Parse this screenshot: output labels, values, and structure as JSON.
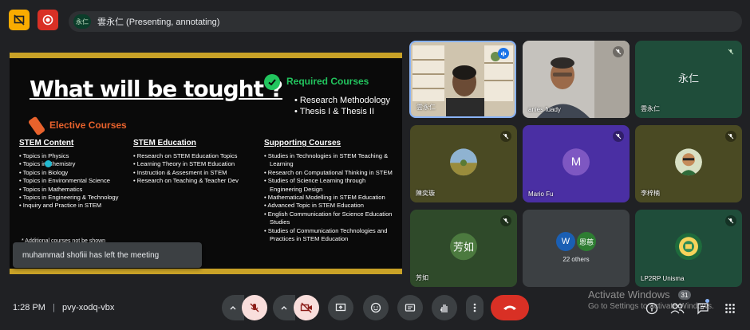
{
  "presenter": {
    "avatar_text": "永仁",
    "label": "雲永仁 (Presenting, annotating)"
  },
  "slide": {
    "title": "What will be tought ?",
    "required": {
      "heading": "Required Courses",
      "items": [
        "Research Methodology",
        "Thesis I & Thesis II"
      ]
    },
    "elective_heading": "Elective Courses",
    "columns": [
      {
        "heading": "STEM Content",
        "items": [
          "Topics in Physics",
          "Topics in Chemistry",
          "Topics in Biology",
          "Topics in Environmental Science",
          "Topics in Mathematics",
          "Topics in Engineering & Technology",
          "Inquiry and Practice in STEM"
        ]
      },
      {
        "heading": "STEM Education",
        "items": [
          "Research on STEM Education Topics",
          "Learning Theory in STEM Education",
          "Instruction & Assesment in STEM",
          "Research on Teaching & Teacher Dev"
        ]
      },
      {
        "heading": "Supporting Courses",
        "items": [
          "Studies in Technologies in STEM Teaching & Learning",
          "Research on Computational Thinking in STEM",
          "Studies of Science Learning through Engineering Design",
          "Mathematical Modelling in STEM Education",
          "Advanced Topic in STEM Education",
          "English Communication for Science Education Studies",
          "Studies of Communication Technologies and Practices in STEM Education"
        ]
      }
    ],
    "note": "* Additional courses not be shown"
  },
  "toast": "muhammad shofiii has left the meeting",
  "participants": {
    "t1": {
      "name": "雲永仁"
    },
    "t2": {
      "name": "anies fuady"
    },
    "t3": {
      "avatar": "永仁",
      "name": "雲永仁"
    },
    "t4": {
      "name": "陳奕璇"
    },
    "t5": {
      "avatar": "M",
      "name": "Mario Fu"
    },
    "t6": {
      "name": "李梓楠"
    },
    "t7": {
      "avatar": "芳如",
      "name": "芳如"
    },
    "t8": {
      "avatar_w": "W",
      "avatar_e": "恩慈",
      "label": "22 others"
    },
    "t9": {
      "name": "LP2RP Unisma"
    }
  },
  "bottom": {
    "time": "1:28 PM",
    "separator": "|",
    "meeting_code": "pvy-xodq-vbx",
    "activate_title": "Activate Windows",
    "activate_sub": "Go to Settings to activate Windows.",
    "people_count": "31"
  },
  "colors": {
    "accent_yellow": "#f9ab00",
    "accent_red": "#d93025",
    "slide_gold": "#c9a227",
    "required_green": "#22c55e",
    "elective_orange": "#e8622c"
  }
}
